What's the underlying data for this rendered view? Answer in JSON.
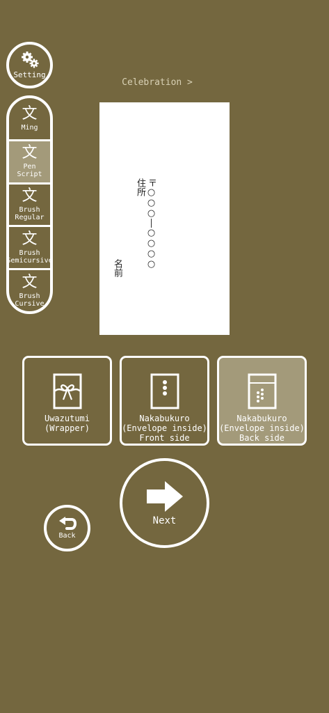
{
  "setting": {
    "label": "Setting",
    "icon": "gears-icon"
  },
  "fonts": [
    {
      "glyph": "文",
      "label": "Ming",
      "selected": false
    },
    {
      "glyph": "文",
      "label": "Pen\nScript",
      "selected": true
    },
    {
      "glyph": "文",
      "label": "Brush\nRegular",
      "selected": false
    },
    {
      "glyph": "文",
      "label": "Brush\nSemicursive",
      "selected": false
    },
    {
      "glyph": "文",
      "label": "Brush\nCursive",
      "selected": false
    }
  ],
  "breadcrumb": "Celebration >",
  "envelope": {
    "address_label": "住所",
    "zip_text": "〒○○○―○○○○",
    "name_label": "名前"
  },
  "modes": [
    {
      "label": "Uwazutumi\n(Wrapper)",
      "icon": "wrapper-icon",
      "selected": false
    },
    {
      "label": "Nakabukuro\n(Envelope inside)\nFront side",
      "icon": "envelope-front-icon",
      "selected": false
    },
    {
      "label": "Nakabukuro\n(Envelope inside)\nBack side",
      "icon": "envelope-back-icon",
      "selected": true
    }
  ],
  "next": {
    "label": "Next"
  },
  "back": {
    "label": "Back"
  },
  "colors": {
    "background": "#74673f",
    "selected": "#a39a7a",
    "accent": "#ffffff"
  }
}
